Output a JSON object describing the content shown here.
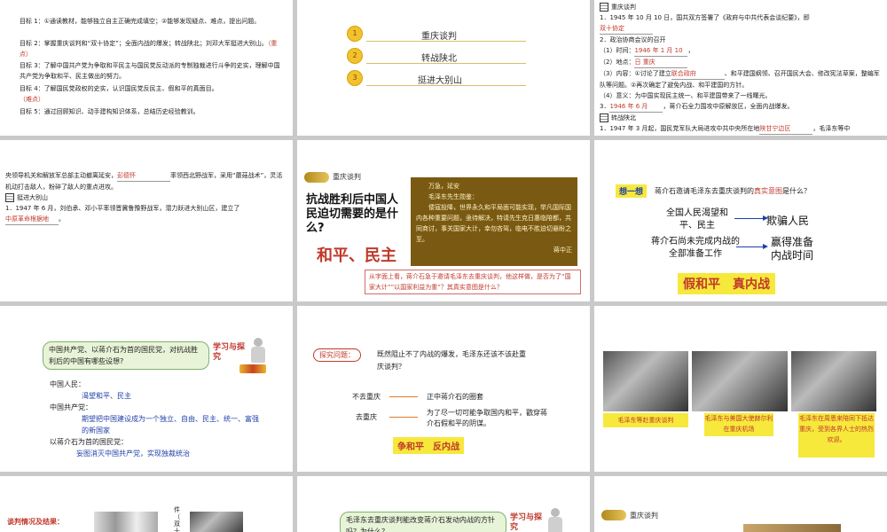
{
  "s1": {
    "goals": [
      "目标 1：①通读教材，能够独立自主正确完成填空；②能够发现疑点、难点，提出问题。",
      "目标 2：掌握重庆谈判和“双十协定”；全面内战的爆发；转战陕北；刘邓大军挺进大别山。",
      "目标 3：了解中国共产党为争取和平民主与国民党反动派的专制独裁进行斗争的史实，理解中国共产党为争取和平、民主做出的努力。",
      "目标 4：了解国民党政权的史实，认识国民党反民主、假和平的真面目。",
      "目标 5：通过回顾知识、动手建构知识体系，总结历史经验教训。"
    ],
    "marks": [
      "（重点）",
      "（难点）"
    ]
  },
  "s2": {
    "items": [
      {
        "num": "1",
        "label": "重庆谈判"
      },
      {
        "num": "2",
        "label": "转战陕北"
      },
      {
        "num": "3",
        "label": "挺进大别山"
      }
    ]
  },
  "s3": {
    "h1": "重庆谈判",
    "l1": "1．1945 年 10 月 10 日，国共双方签署了《政府与中共代表会谈纪要》，即",
    "a1": "双十协定",
    "l2": "2．政治协商会议的召开",
    "l3": "（1）时间：",
    "a3": "1946 年 1 月 10",
    "l4": "（2）地点：",
    "a4": "日 重庆",
    "l5a": "（3）内容：①讨论了建立",
    "a5": "联合政府",
    "l5b": "、和平建国纲领、召开国民大会、修改宪法草案，整编军队等问题。②再次确定了避免内战、和平建国的方针。",
    "l6": "（4）意义：为中国实现民主统一、和平建国带来了一线曙光。",
    "l7a": "3．",
    "a7": "1946 年 6 月",
    "l7b": "，蒋介石全力围攻中原解放区，全面内战爆发。",
    "h2": "转战陕北",
    "l8a": "1．1947 年 3 月起，国民党军队大局进攻中共中央所在地",
    "a8": "陕甘宁边区",
    "l8b": "，毛泽东等中"
  },
  "s4": {
    "l1a": "央领导机关和解放军总部主动撤离延安，",
    "a1": "彭德怀",
    "l1b": "率领西北野战军，采用“蘑菇战术”，灵活机动打击敌人，粉碎了敌人的重点进攻。",
    "h": "挺进大别山",
    "l2": "1．1947 年 6 月，刘伯承、邓小平率领晋冀鲁豫野战军，潜力跃进大别山区，建立了",
    "a2": "中原革命根据地",
    "l2b": "。"
  },
  "s5": {
    "tag": "重庆谈判",
    "q": "抗战胜利后中国人民迫切需要的是什么?",
    "ans": "和平、民主",
    "tel": [
      "万急，延安",
      "毛泽东先生勋鉴：",
      "倭寇投降，世界永久和平局面可能实现，举凡国际国内各种重要问题，亟待解决，特请先生克日惠临陪都，共同商讨，事关国家大计，幸勿吝驾，临电不胜迫切悬盼之至。",
      "蒋中正"
    ],
    "note": "从字面上看，蒋介石急于邀请毛泽东去重庆谈判，他这样做，是否为了“国家大计”“以国家利益为重”？其真实意图是什么？"
  },
  "s6": {
    "tag": "想一想",
    "q": "蒋介石邀请毛泽东去重庆谈判的",
    "qh": "真实意图",
    "qe": "是什么？",
    "left1": "全国人民渴望和平、民主",
    "right1": "欺骗人民",
    "left2": "蒋介石尚未完成内战的全部准备工作",
    "right2": "赢得准备内战时间",
    "ans": "假和平　真内战"
  },
  "s7": {
    "q": "中国共产党、以蒋介石为首的国民党，对抗战胜利后的中国有哪些设想?",
    "tag": "学习与探究",
    "p1": "中国人民：",
    "a1": "渴望和平、民主",
    "p2": "中国共产党：",
    "a2": "期望把中国建设成为一个独立、自由、民主、统一、富强的新国家",
    "p3": "以蒋介石为首的国民党：",
    "a3": "妄图消灭中国共产党，实现独裁统治"
  },
  "s8": {
    "tag": "探究问题：",
    "q": "既然阻止不了内战的爆发，毛泽东还该不该赴重庆谈判？",
    "l1": "不去重庆",
    "r1": "正中蒋介石的圈套",
    "l2": "去重庆",
    "r2": "为了尽一切可能争取国内和平，戳穿蒋介石假和平的阴谋。",
    "ans": "争和平　反内战"
  },
  "s9": {
    "c1": "毛泽东等赴重庆谈判",
    "c2": "毛泽东与美国大使赫尔利在重庆机场",
    "c3": "毛泽东在周恩来陪同下抵达重庆，受到各界人士的热烈欢迎。"
  },
  "s10": {
    "t": "谈判情况及结果：",
    "side": "件（双十协"
  },
  "s11": {
    "q": "毛泽东去重庆谈判能改变蒋介石发动内战的方针吗？为什么？",
    "tag": "学习与探究"
  },
  "s12": {
    "tag": "重庆谈判"
  }
}
